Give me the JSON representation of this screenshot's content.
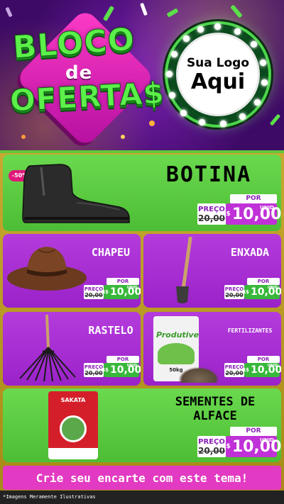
{
  "header": {
    "title_line1": "BLOCO",
    "title_line2": "de",
    "title_line3": "OFERTA$",
    "logo_line1": "Sua Logo",
    "logo_line2": "Aqui"
  },
  "products": [
    {
      "name": "BOTINA",
      "badge": "-50%",
      "por": "POR",
      "preco": "PREÇO",
      "old": "20,00",
      "currency": "R$",
      "new": "10,00",
      "unid": "UNID"
    },
    {
      "name": "CHAPEU",
      "por": "POR",
      "preco": "PREÇO",
      "old": "20,00",
      "currency": "R$",
      "new": "10,00",
      "unid": "UNID"
    },
    {
      "name": "ENXADA",
      "por": "POR",
      "preco": "PREÇO",
      "old": "20,00",
      "currency": "R$",
      "new": "10,00",
      "unid": "UNID"
    },
    {
      "name": "RASTELO",
      "por": "POR",
      "preco": "PREÇO",
      "old": "20,00",
      "currency": "R$",
      "new": "10,00",
      "unid": "UNID"
    },
    {
      "name": "FERTILIZANTES",
      "por": "POR",
      "preco": "PREÇO",
      "old": "20,00",
      "currency": "R$",
      "new": "10,00",
      "unid": "UNID",
      "package_brand": "Produtive",
      "package_weight": "50kg"
    },
    {
      "name": "SEMENTES DE ALFACE",
      "por": "POR",
      "preco": "PREÇO",
      "old": "20,00",
      "currency": "R$",
      "new": "10,00",
      "unid": "UNID",
      "package_brand": "SAKATA"
    }
  ],
  "cta": "Crie seu encarte com este tema!",
  "footnote": "*Imagens Meramente Ilustrativas",
  "colors": {
    "green_card": "#5ecb42",
    "purple_card": "#a52ed0",
    "cta": "#e23ac2",
    "accent_green": "#38b83a",
    "accent_purple": "#c031d8"
  }
}
